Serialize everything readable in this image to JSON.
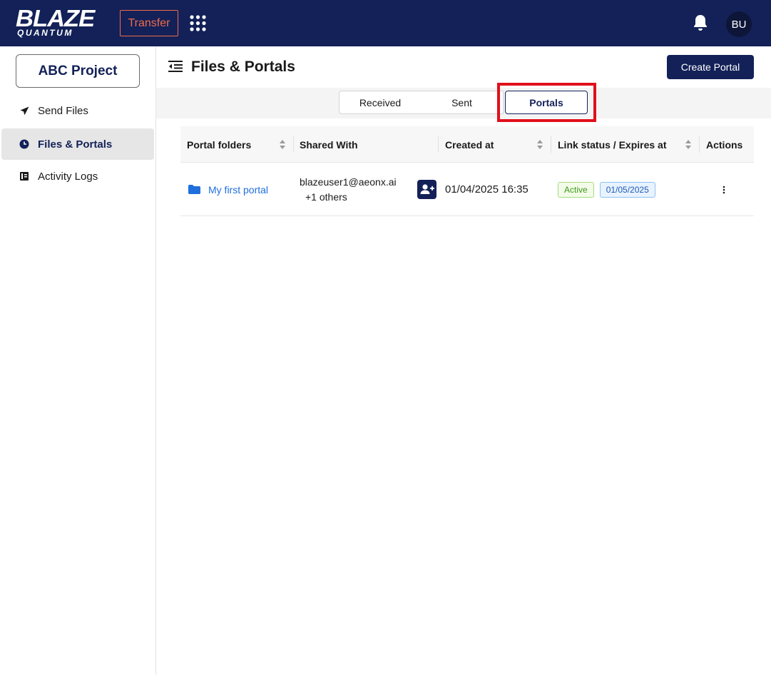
{
  "app": {
    "logo_main": "BLAZE",
    "logo_sub": "QUANTUM",
    "transfer_label": "Transfer",
    "user_initials": "BU"
  },
  "sidebar": {
    "project_label": "ABC Project",
    "items": [
      {
        "label": "Send Files",
        "icon": "send-icon",
        "active": false
      },
      {
        "label": "Files & Portals",
        "icon": "clock-icon",
        "active": true
      },
      {
        "label": "Activity Logs",
        "icon": "log-book-icon",
        "active": false
      }
    ]
  },
  "header": {
    "title": "Files & Portals",
    "create_label": "Create Portal"
  },
  "tabs": [
    {
      "label": "Received"
    },
    {
      "label": "Sent"
    },
    {
      "label": "Portals",
      "selected": true
    }
  ],
  "table": {
    "columns": [
      "Portal folders",
      "Shared With",
      "Created at",
      "Link status / Expires at",
      "Actions"
    ],
    "rows": [
      {
        "folder": "My first portal",
        "shared_email": "blazeuser1@aeonx.ai",
        "shared_others": "+1 others",
        "created_at": "01/04/2025 16:35",
        "status": "Active",
        "expires": "01/05/2025"
      }
    ]
  },
  "colors": {
    "brand_navy": "#132158",
    "accent_orange": "#f06b4a",
    "link_blue": "#1f6fdc",
    "highlight_red": "#e0101b"
  }
}
